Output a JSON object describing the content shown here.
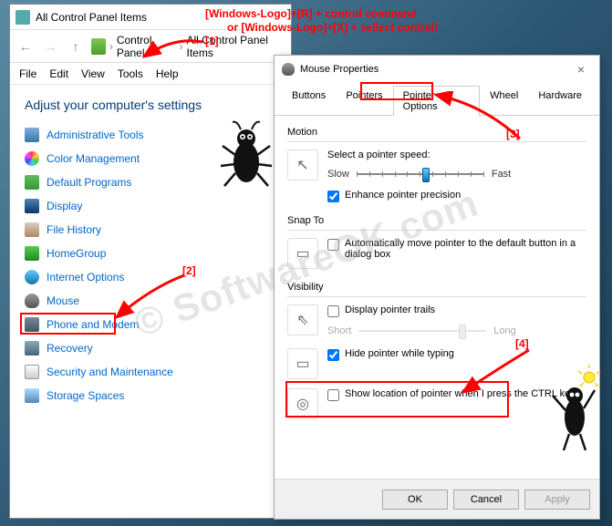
{
  "ctrlpanel": {
    "title": "All Control Panel Items",
    "breadcrumb": {
      "a": "Control Panel",
      "b": "All Control Panel Items"
    },
    "menu": [
      "File",
      "Edit",
      "View",
      "Tools",
      "Help"
    ],
    "heading": "Adjust your computer's settings",
    "items": [
      "Administrative Tools",
      "Color Management",
      "Default Programs",
      "Display",
      "File History",
      "HomeGroup",
      "Internet Options",
      "Mouse",
      "Phone and Modem",
      "Recovery",
      "Security and Maintenance",
      "Storage Spaces"
    ]
  },
  "mousedlg": {
    "title": "Mouse Properties",
    "tabs": [
      "Buttons",
      "Pointers",
      "Pointer Options",
      "Wheel",
      "Hardware"
    ],
    "active_tab_index": 2,
    "motion": {
      "group": "Motion",
      "label": "Select a pointer speed:",
      "slow": "Slow",
      "fast": "Fast",
      "enhance": "Enhance pointer precision",
      "enhance_checked": true
    },
    "snapto": {
      "group": "Snap To",
      "label": "Automatically move pointer to the default button in a dialog box",
      "checked": false
    },
    "visibility": {
      "group": "Visibility",
      "trails": "Display pointer trails",
      "trails_checked": false,
      "short": "Short",
      "long": "Long",
      "hide": "Hide pointer while typing",
      "hide_checked": true,
      "ctrl": "Show location of pointer when I press the CTRL key",
      "ctrl_checked": false
    },
    "buttons": {
      "ok": "OK",
      "cancel": "Cancel",
      "apply": "Apply"
    }
  },
  "annots": {
    "top_text1": "[Windows-Logo]+[R] + control command",
    "top_text2": "or [Windows-Logo]+[X] + sellect controll",
    "n1": "[1]",
    "n2": "[2]",
    "n3": "[3]",
    "n4": "[4]"
  },
  "watermark": "© SoftwareOK.com"
}
